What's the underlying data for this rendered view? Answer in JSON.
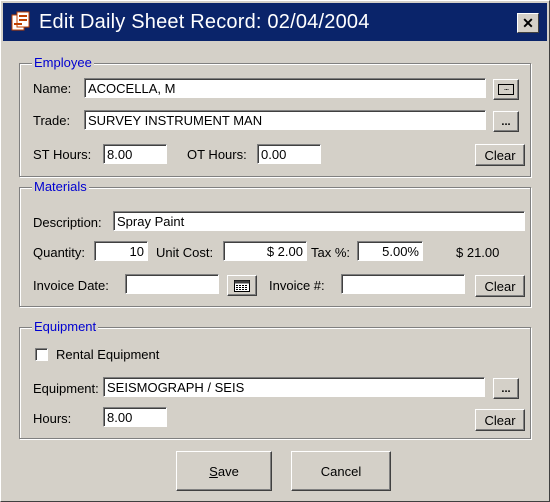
{
  "window": {
    "title": "Edit Daily Sheet Record: 02/04/2004",
    "close_glyph": "✕"
  },
  "employee": {
    "legend": "Employee",
    "name_label": "Name:",
    "name_value": "ACOCELLA, M",
    "trade_label": "Trade:",
    "trade_value": "SURVEY INSTRUMENT MAN",
    "st_hours_label": "ST Hours:",
    "st_hours_value": "8.00",
    "ot_hours_label": "OT Hours:",
    "ot_hours_value": "0.00",
    "browse_label": "...",
    "clear_label": "Clear"
  },
  "materials": {
    "legend": "Materials",
    "description_label": "Description:",
    "description_value": "Spray Paint",
    "quantity_label": "Quantity:",
    "quantity_value": "10",
    "unit_cost_label": "Unit Cost:",
    "unit_cost_value": "$ 2.00",
    "tax_label": "Tax %:",
    "tax_value": "5.00%",
    "total_value": "$ 21.00",
    "invoice_date_label": "Invoice Date:",
    "invoice_date_value": "",
    "invoice_num_label": "Invoice #:",
    "invoice_num_value": "",
    "clear_label": "Clear"
  },
  "equipment": {
    "legend": "Equipment",
    "rental_label": "Rental Equipment",
    "rental_checked": false,
    "equipment_label": "Equipment:",
    "equipment_value": "SEISMOGRAPH / SEIS",
    "hours_label": "Hours:",
    "hours_value": "8.00",
    "browse_label": "...",
    "clear_label": "Clear"
  },
  "footer": {
    "save_label_u": "S",
    "save_label_rest": "ave",
    "cancel_label": "Cancel"
  },
  "colors": {
    "titlebar": "#0a246a",
    "legend": "#0000d0",
    "face": "#d4d0c8"
  }
}
